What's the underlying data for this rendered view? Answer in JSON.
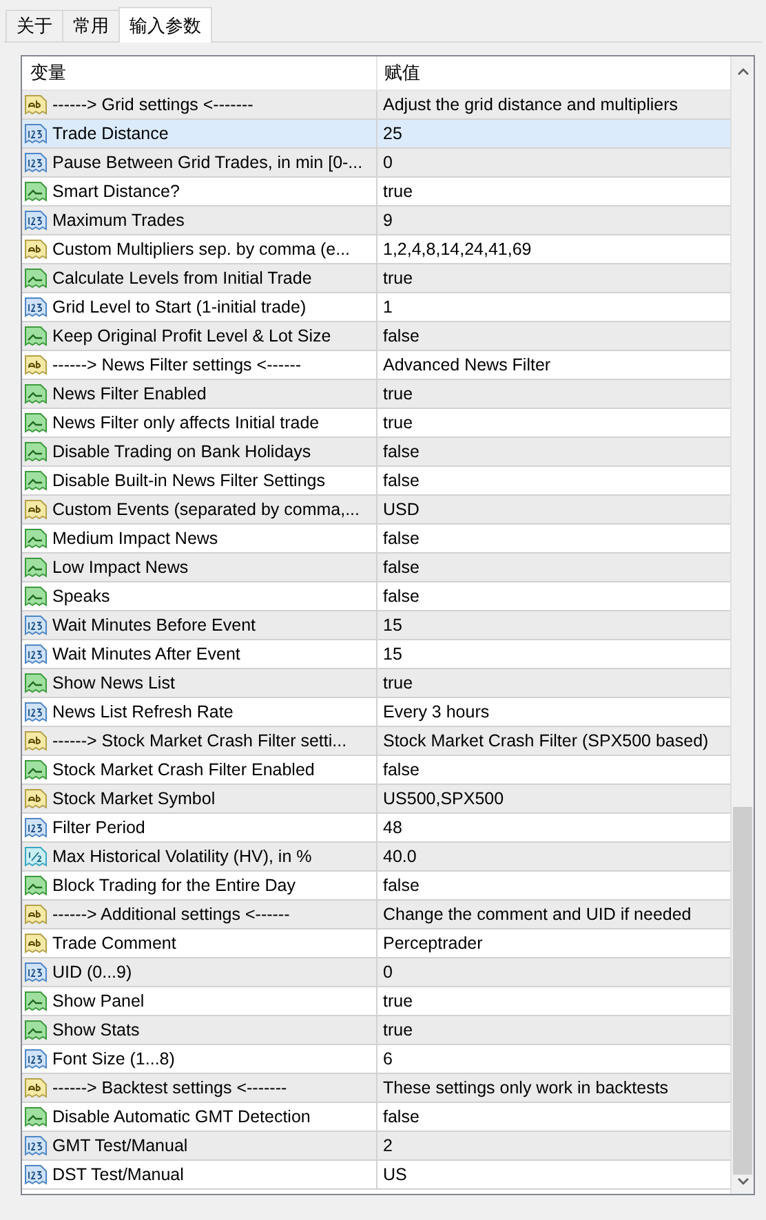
{
  "tabs": [
    {
      "label": "关于",
      "selected": false
    },
    {
      "label": "常用",
      "selected": false
    },
    {
      "label": "输入参数",
      "selected": true
    }
  ],
  "table": {
    "columns": [
      "变量",
      "赋值"
    ],
    "rows": [
      {
        "kind": "string",
        "name": "------> Grid settings <-------",
        "value": "Adjust the grid distance and multipliers",
        "selected": false
      },
      {
        "kind": "int",
        "name": "Trade Distance",
        "value": "25",
        "selected": true
      },
      {
        "kind": "int",
        "name": "Pause Between Grid Trades, in min [0-...",
        "value": "0",
        "selected": false
      },
      {
        "kind": "bool",
        "name": "Smart Distance?",
        "value": "true",
        "selected": false
      },
      {
        "kind": "int",
        "name": "Maximum Trades",
        "value": "9",
        "selected": false
      },
      {
        "kind": "string",
        "name": "Custom Multipliers sep. by comma (e...",
        "value": "1,2,4,8,14,24,41,69",
        "selected": false
      },
      {
        "kind": "bool",
        "name": "Calculate Levels from Initial Trade",
        "value": "true",
        "selected": false
      },
      {
        "kind": "int",
        "name": "Grid Level to Start (1-initial trade)",
        "value": "1",
        "selected": false
      },
      {
        "kind": "bool",
        "name": "Keep Original Profit Level & Lot Size",
        "value": "false",
        "selected": false
      },
      {
        "kind": "string",
        "name": "------> News Filter settings <------",
        "value": "Advanced News Filter",
        "selected": false
      },
      {
        "kind": "bool",
        "name": "News Filter Enabled",
        "value": "true",
        "selected": false
      },
      {
        "kind": "bool",
        "name": "News Filter only affects Initial trade",
        "value": "true",
        "selected": false
      },
      {
        "kind": "bool",
        "name": "Disable Trading on Bank Holidays",
        "value": "false",
        "selected": false
      },
      {
        "kind": "bool",
        "name": "Disable Built-in News Filter Settings",
        "value": "false",
        "selected": false
      },
      {
        "kind": "string",
        "name": "Custom Events (separated by comma,...",
        "value": "USD",
        "selected": false
      },
      {
        "kind": "bool",
        "name": "Medium Impact News",
        "value": "false",
        "selected": false
      },
      {
        "kind": "bool",
        "name": "Low Impact News",
        "value": "false",
        "selected": false
      },
      {
        "kind": "bool",
        "name": "Speaks",
        "value": "false",
        "selected": false
      },
      {
        "kind": "int",
        "name": "Wait Minutes Before Event",
        "value": "15",
        "selected": false
      },
      {
        "kind": "int",
        "name": "Wait Minutes After Event",
        "value": "15",
        "selected": false
      },
      {
        "kind": "bool",
        "name": "Show News List",
        "value": "true",
        "selected": false
      },
      {
        "kind": "int",
        "name": "News List Refresh Rate",
        "value": "Every 3 hours",
        "selected": false
      },
      {
        "kind": "string",
        "name": "------> Stock Market Crash Filter setti...",
        "value": "Stock Market Crash Filter (SPX500 based)",
        "selected": false
      },
      {
        "kind": "bool",
        "name": "Stock Market Crash Filter Enabled",
        "value": "false",
        "selected": false
      },
      {
        "kind": "string",
        "name": "Stock Market Symbol",
        "value": "US500,SPX500",
        "selected": false
      },
      {
        "kind": "int",
        "name": "Filter Period",
        "value": "48",
        "selected": false
      },
      {
        "kind": "double",
        "name": "Max Historical Volatility (HV), in %",
        "value": "40.0",
        "selected": false
      },
      {
        "kind": "bool",
        "name": "Block Trading for the Entire Day",
        "value": "false",
        "selected": false
      },
      {
        "kind": "string",
        "name": "------> Additional settings <------",
        "value": "Change the comment and UID if needed",
        "selected": false
      },
      {
        "kind": "string",
        "name": "Trade Comment",
        "value": "Perceptrader",
        "selected": false
      },
      {
        "kind": "int",
        "name": "UID (0...9)",
        "value": "0",
        "selected": false
      },
      {
        "kind": "bool",
        "name": "Show Panel",
        "value": "true",
        "selected": false
      },
      {
        "kind": "bool",
        "name": "Show Stats",
        "value": "true",
        "selected": false
      },
      {
        "kind": "int",
        "name": "Font Size (1...8)",
        "value": "6",
        "selected": false
      },
      {
        "kind": "string",
        "name": "------> Backtest settings <-------",
        "value": "These settings only work in backtests",
        "selected": false
      },
      {
        "kind": "bool",
        "name": "Disable Automatic GMT Detection",
        "value": "false",
        "selected": false
      },
      {
        "kind": "int",
        "name": "GMT Test/Manual",
        "value": "2",
        "selected": false
      },
      {
        "kind": "int",
        "name": "DST Test/Manual",
        "value": "US",
        "selected": false
      }
    ]
  }
}
